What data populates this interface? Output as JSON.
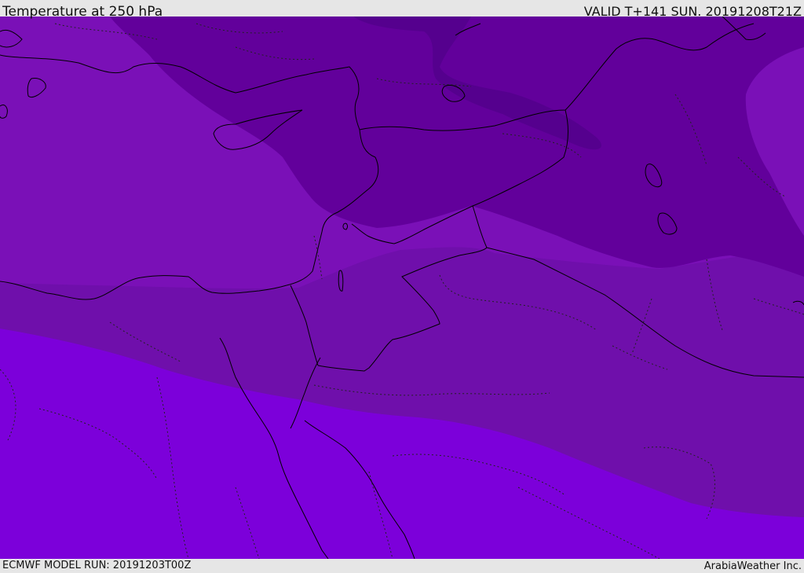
{
  "header": {
    "title": "Temperature at 250 hPa",
    "valid_time": "VALID T+141 SUN. 20191208T21Z"
  },
  "footer": {
    "model_run": "ECMWF MODEL RUN: 20191203T00Z",
    "credit": "ArabiaWeather Inc."
  },
  "map": {
    "region": "Eastern Mediterranean and Middle East",
    "field": "temperature",
    "level": "250 hPa",
    "colors": {
      "band_darkest": "#55008e",
      "band_dark": "#62009b",
      "band_mid": "#6f0fab",
      "band_light": "#7a10b7",
      "band_lightest": "#7c00da",
      "coastline": "#000000",
      "borders": "#000000"
    }
  }
}
